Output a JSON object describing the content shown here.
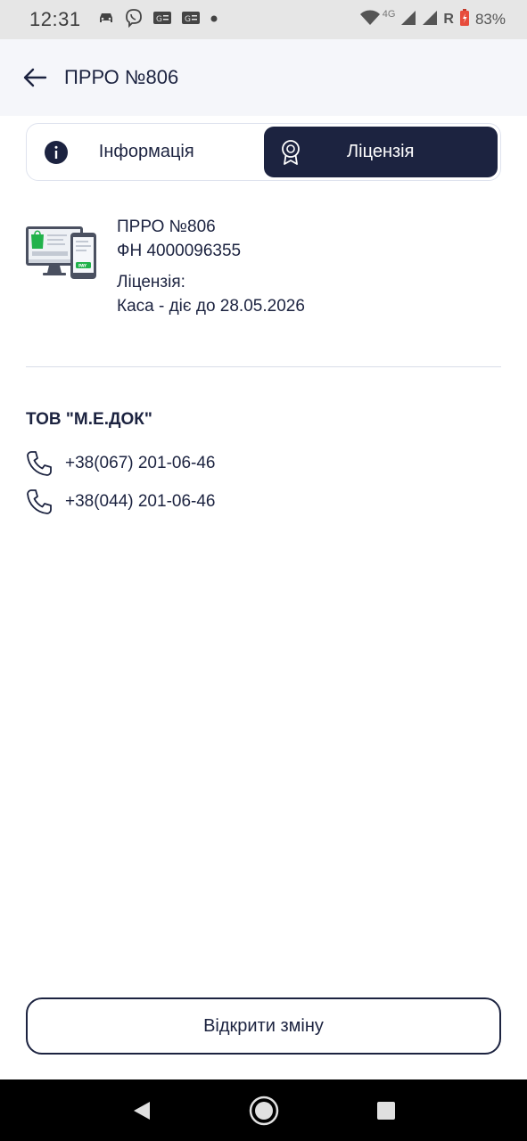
{
  "status_bar": {
    "time": "12:31",
    "battery": "83%",
    "network_label": "4G",
    "roaming": "R",
    "icons": [
      "car-icon",
      "viber-icon",
      "sim-icon",
      "sim-icon",
      "dot-icon",
      "wifi-icon",
      "signal-icon",
      "signal-icon",
      "battery-icon"
    ]
  },
  "header": {
    "title": "ПРРО №806",
    "back_icon": "arrow-left-icon"
  },
  "tabs": [
    {
      "label": "Інформація",
      "icon": "info-icon",
      "active": false
    },
    {
      "label": "Ліцензія",
      "icon": "award-icon",
      "active": true
    }
  ],
  "device": {
    "name": "ПРРО №806",
    "fiscal_number": "ФН 4000096355",
    "license_label": "Ліцензія:",
    "license_value": "Каса - діє до 28.05.2026"
  },
  "company": {
    "name": "ТОВ \"М.Е.ДОК\"",
    "phones": [
      "+38(067) 201-06-46",
      "+38(044) 201-06-46"
    ]
  },
  "actions": {
    "open_shift": "Відкрити зміну"
  },
  "colors": {
    "primary": "#1c2340",
    "accent_green": "#21b24b",
    "header_bg": "#f5f6fa"
  }
}
